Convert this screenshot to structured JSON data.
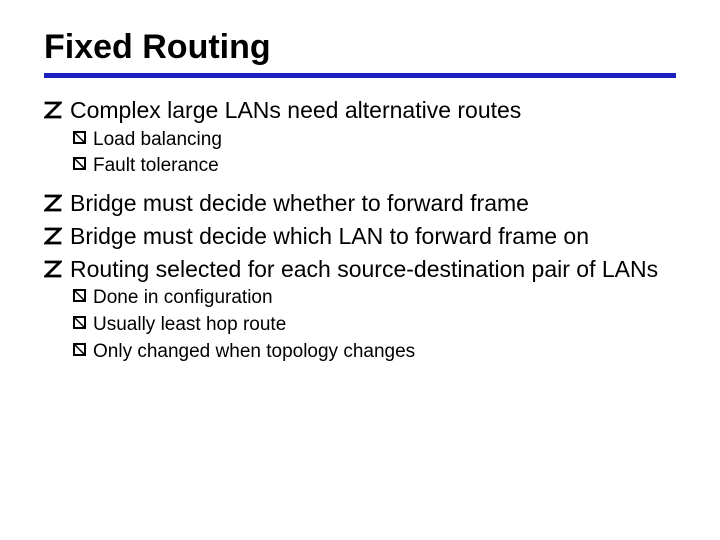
{
  "title": "Fixed Routing",
  "bullets": [
    {
      "text": "Complex large LANs need alternative routes",
      "sub": [
        "Load balancing",
        "Fault tolerance"
      ]
    },
    {
      "text": "Bridge must decide whether to forward frame",
      "sub": []
    },
    {
      "text": "Bridge must decide which LAN to forward frame on",
      "sub": []
    },
    {
      "text": "Routing selected for each source-destination pair of LANs",
      "sub": [
        "Done in configuration",
        "Usually least hop route",
        "Only changed when topology changes"
      ]
    }
  ]
}
